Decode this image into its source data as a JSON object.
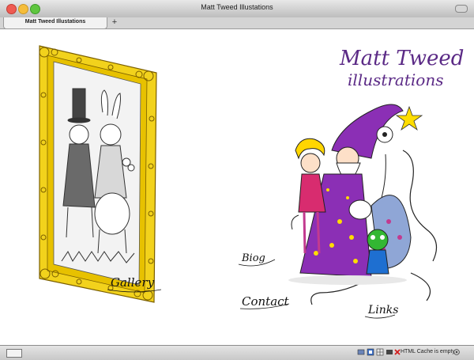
{
  "window": {
    "title": "Matt Tweed Illustations"
  },
  "tabs": [
    {
      "label": "Matt Tweed Illustations"
    }
  ],
  "tab_add_label": "+",
  "site": {
    "logo_line1": "Matt Tweed",
    "logo_line2": "illustrations",
    "nav": {
      "gallery": "Gallery",
      "biog": "Biog",
      "contact": "Contact",
      "links": "Links"
    }
  },
  "statusbar": {
    "cache_text": "HTML Cache is empty"
  },
  "colors": {
    "frame_gold": "#f2d21c",
    "wizard_purple": "#8b2fb5",
    "logo_purple": "#5b2a86",
    "girl_hair": "#ffd600",
    "alien_green": "#33b733"
  }
}
